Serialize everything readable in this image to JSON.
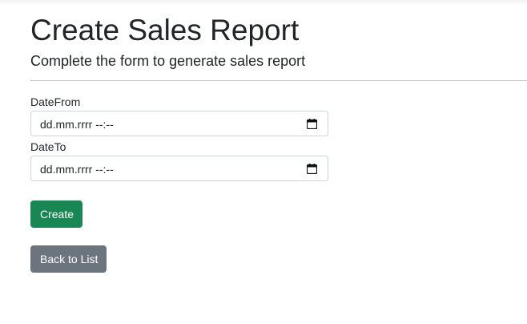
{
  "page": {
    "title": "Create Sales Report",
    "subtitle": "Complete the form to generate sales report"
  },
  "form": {
    "date_from": {
      "label": "DateFrom",
      "value": "dd.mm.rrrr --:--",
      "icon": "calendar-icon"
    },
    "date_to": {
      "label": "DateTo",
      "value": "dd.mm.rrrr --:--",
      "icon": "calendar-icon"
    },
    "submit_label": "Create"
  },
  "nav": {
    "back_label": "Back to List"
  },
  "colors": {
    "create_button": "#198754",
    "back_button": "#6c757d",
    "input_border": "#ced4da"
  }
}
